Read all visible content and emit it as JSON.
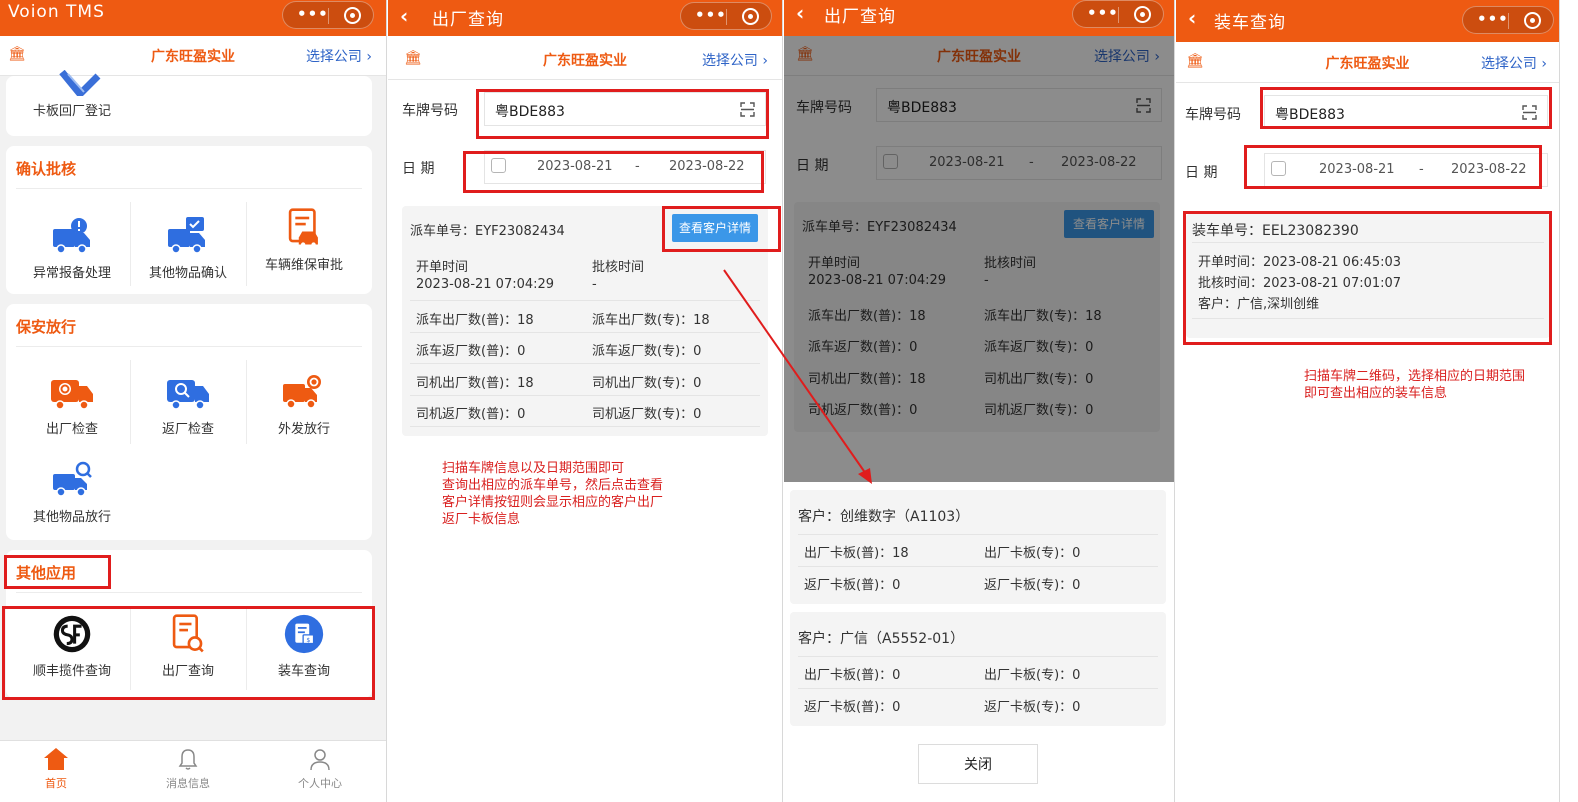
{
  "panel1": {
    "app_title": "Voion TMS",
    "company": "广东旺盈实业",
    "select_company": "选择公司 ›",
    "partial_item": "卡板回厂登记",
    "sections": [
      {
        "title": "确认批核",
        "items": [
          "异常报备处理",
          "其他物品确认",
          "车辆维保审批"
        ]
      },
      {
        "title": "保安放行",
        "items": [
          "出厂检查",
          "返厂检查",
          "外发放行",
          "其他物品放行"
        ]
      },
      {
        "title": "其他应用",
        "items": [
          "顺丰揽件查询",
          "出厂查询",
          "装车查询"
        ]
      }
    ],
    "tabs": [
      "首页",
      "消息信息",
      "个人中心"
    ]
  },
  "exit_query": {
    "title": "出厂查询",
    "company": "广东旺盈实业",
    "select_company": "选择公司 ›",
    "plate_label": "车牌号码",
    "plate_value": "粤BDE883",
    "date_label": "日 期",
    "date_from": "2023-08-21",
    "date_sep": "-",
    "date_to": "2023-08-22",
    "dispatch_label": "派车单号：EYF23082434",
    "detail_button": "查看客户详情",
    "open_time_label": "开单时间",
    "open_time_value": "2023-08-21 07:04:29",
    "approve_time_label": "批核时间",
    "approve_time_value": "-",
    "stats": [
      [
        "派车出厂数(普)：18",
        "派车出厂数(专)：18"
      ],
      [
        "派车返厂数(普)：0",
        "派车返厂数(专)：0"
      ],
      [
        "司机出厂数(普)：18",
        "司机出厂数(专)：0"
      ],
      [
        "司机返厂数(普)：0",
        "司机返厂数(专)：0"
      ]
    ],
    "note": [
      "扫描车牌信息以及日期范围即可",
      "查询出相应的派车单号，然后点击查看",
      "客户详情按钮则会显示相应的客户出厂",
      "返厂卡板信息"
    ]
  },
  "customer_popup": {
    "customers": [
      {
        "name": "客户：创维数字（A1103）",
        "rows": [
          [
            "出厂卡板(普)：18",
            "出厂卡板(专)：0"
          ],
          [
            "返厂卡板(普)：0",
            "返厂卡板(专)：0"
          ]
        ]
      },
      {
        "name": "客户：广信（A5552-01）",
        "rows": [
          [
            "出厂卡板(普)：0",
            "出厂卡板(专)：0"
          ],
          [
            "返厂卡板(普)：0",
            "返厂卡板(专)：0"
          ]
        ]
      }
    ],
    "close_label": "关闭"
  },
  "load_query": {
    "title": "装车查询",
    "company": "广东旺盈实业",
    "select_company": "选择公司 ›",
    "plate_label": "车牌号码",
    "plate_value": "粤BDE883",
    "date_label": "日 期",
    "date_from": "2023-08-21",
    "date_sep": "-",
    "date_to": "2023-08-22",
    "load_no": "装车单号：EEL23082390",
    "open_time": "开单时间：2023-08-21 06:45:03",
    "approve_time": "批核时间：2023-08-21 07:01:07",
    "customer": "客户：广信,深圳创维",
    "note": [
      "扫描车牌二维码，选择相应的日期范围",
      "即可查出相应的装车信息"
    ]
  },
  "colors": {
    "brand": "#ee5a12",
    "link": "#2f64c7",
    "annotation": "#e01d1d",
    "button": "#3b97e8"
  }
}
